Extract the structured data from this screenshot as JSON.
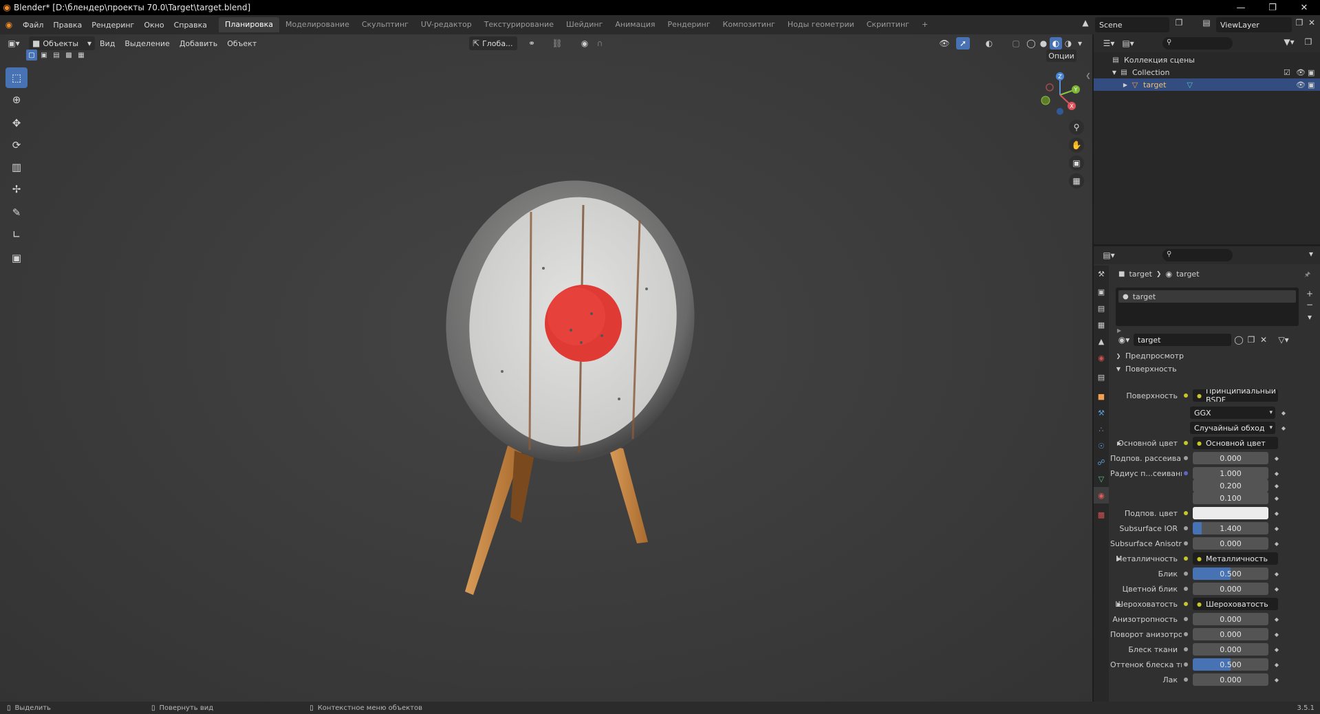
{
  "window": {
    "title": "Blender* [D:\\блендер\\проекты 70.0\\Target\\target.blend]"
  },
  "menu": {
    "items": [
      "Файл",
      "Правка",
      "Рендеринг",
      "Окно",
      "Справка"
    ]
  },
  "workspaces": [
    "Планировка",
    "Моделирование",
    "Скульптинг",
    "UV-редактор",
    "Текстурирование",
    "Шейдинг",
    "Анимация",
    "Рендеринг",
    "Композитинг",
    "Ноды геометрии",
    "Скриптинг"
  ],
  "workspace_add": "+",
  "scene": {
    "name": "Scene",
    "view_layer": "ViewLayer"
  },
  "viewport": {
    "mode": "Объекты",
    "menu": [
      "Вид",
      "Выделение",
      "Добавить",
      "Объект"
    ],
    "orientation": "Глоба...",
    "options": "Опции",
    "gizmo_axes": {
      "x": "X",
      "y": "Y",
      "z": "Z"
    }
  },
  "outliner": {
    "root": "Коллекция сцены",
    "collection": "Collection",
    "object": "target"
  },
  "properties": {
    "breadcrumb": [
      "target",
      "target"
    ],
    "slot": "target",
    "material_name": "target",
    "panels": {
      "preview": "Предпросмотр",
      "surface": "Поверхность"
    },
    "rows": [
      {
        "label": "Поверхность",
        "kind": "link",
        "value": "Принципиальный BSDF"
      },
      {
        "label": "",
        "kind": "select",
        "value": "GGX"
      },
      {
        "label": "",
        "kind": "select",
        "value": "Случайный обход"
      },
      {
        "label": "Основной цвет",
        "kind": "link",
        "value": "Основной цвет"
      },
      {
        "label": "Подпов. рассеива...",
        "kind": "num",
        "value": "0.000",
        "fill": 0
      },
      {
        "label": "Радиус п...сеивания",
        "kind": "num",
        "value": "1.000",
        "fill": 0
      },
      {
        "label": "",
        "kind": "num",
        "value": "0.200",
        "fill": 0
      },
      {
        "label": "",
        "kind": "num",
        "value": "0.100",
        "fill": 0
      },
      {
        "label": "Подпов. цвет",
        "kind": "color",
        "value": "",
        "color": "#ececec"
      },
      {
        "label": "Subsurface IOR",
        "kind": "num",
        "value": "1.400",
        "fill": 0.12
      },
      {
        "label": "Subsurface Anisotr...",
        "kind": "num",
        "value": "0.000",
        "fill": 0
      },
      {
        "label": "Металличность",
        "kind": "link",
        "value": "Металличность"
      },
      {
        "label": "Блик",
        "kind": "num",
        "value": "0.500",
        "fill": 0.5
      },
      {
        "label": "Цветной блик",
        "kind": "num",
        "value": "0.000",
        "fill": 0
      },
      {
        "label": "Шероховатость",
        "kind": "link",
        "value": "Шероховатость"
      },
      {
        "label": "Анизотропность",
        "kind": "num",
        "value": "0.000",
        "fill": 0
      },
      {
        "label": "Поворот анизотро...",
        "kind": "num",
        "value": "0.000",
        "fill": 0
      },
      {
        "label": "Блеск ткани",
        "kind": "num",
        "value": "0.000",
        "fill": 0
      },
      {
        "label": "Оттенок блеска тк...",
        "kind": "num",
        "value": "0.500",
        "fill": 0.5
      },
      {
        "label": "Лак",
        "kind": "num",
        "value": "0.000",
        "fill": 0
      }
    ]
  },
  "statusbar": {
    "select": "Выделить",
    "rotate": "Повернуть вид",
    "context": "Контекстное меню объектов",
    "version": "3.5.1"
  },
  "colors": {
    "accent": "#4772b3",
    "target_red": "#e03a35",
    "wood": "#c98a45"
  }
}
